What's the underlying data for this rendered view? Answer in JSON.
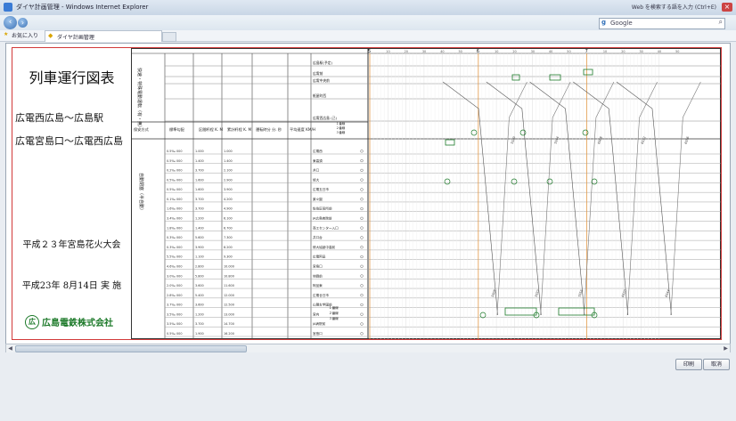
{
  "window": {
    "title": "ダイヤ計画管理 - Windows Internet Explorer",
    "search_hint": "Web を検索する語を入力 (Ctrl+E)",
    "close_label": "×"
  },
  "navbar": {
    "back_icon": "back-arrow-icon",
    "forward_icon": "forward-arrow-icon",
    "search_engine": "Google"
  },
  "favbar": {
    "favorites_label": "お気に入り",
    "tab_label": "ダイヤ計画管理"
  },
  "sheet": {
    "main_title": "列車運行図表",
    "section1": "広電西広島～広島駅",
    "section2": "広電宮島口～広電西広島",
    "event": "平成２３年宮島花火大会",
    "date": "平成23年 8月14日 実 施",
    "company": "広島電鉄株式会社",
    "logo_text": "広"
  },
  "table": {
    "header_vertical_top": "快速・特殊電動運転（有・無）",
    "header_row": [
      "保安方式",
      "標準勾配",
      "区間粁程 K. M",
      "累計粁程 K. M",
      "運転時分 分. 秒",
      "平均速度 KM/H"
    ],
    "vertical_label": "自動閉塞（半自動）",
    "gradients": [
      "0.5‰ 000",
      "0.5‰ 000",
      "0.2‰ 000",
      "0.5‰ 000",
      "0.5‰ 000",
      "0.1‰ 000",
      "1.6‰ 000",
      "3.4‰ 000",
      "1.8‰ 000",
      "0.3‰ 000",
      "0.3‰ 000",
      "5.5‰ 000",
      "4.6‰ 000",
      "3.0‰ 000",
      "2.0‰ 000",
      "2.8‰ 000",
      "3.7‰ 000",
      "3.5‰ 000",
      "3.5‰ 000",
      "0.5‰ 000"
    ],
    "section_km": [
      "1.000",
      "1.400",
      "3.700",
      "1.600",
      "1.600",
      "3.700",
      "3.700",
      "1.200",
      "1.400",
      "5.600",
      "3.900",
      "1.100",
      "2.800",
      "5.800",
      "3.600",
      "5.400",
      "3.600",
      "1.200",
      "3.700",
      "1.900"
    ],
    "cumulative_km": [
      "1.000",
      "1.400",
      "2.100",
      "2.900",
      "3.900",
      "4.200",
      "4.900",
      "6.100",
      "6.700",
      "7.300",
      "8.200",
      "9.300",
      "10.000",
      "10.800",
      "11.600",
      "12.000",
      "12.500",
      "13.000",
      "14.700",
      "16.200"
    ],
    "stations_top": [
      "広島駅(予定)",
      "広電前",
      "広電中央前",
      "紙屋町西",
      "広電西広島 (己)"
    ],
    "stations": [
      "広電西",
      "東高須",
      "井口",
      "修大",
      "広電五日市",
      "楽々園",
      "佐伯区役所前",
      "JA広島病院前",
      "商工センター入口",
      "井口台",
      "修大協創中高前",
      "広電阿品",
      "宮島口",
      "地御前",
      "阿品東",
      "広電廿日市",
      "山陽女学園前",
      "宮内",
      "JA病院前",
      "宮島口"
    ],
    "track_labels": [
      "１番線",
      "２番線",
      "３番線"
    ]
  },
  "diagram": {
    "hour_marks": [
      "5",
      "6",
      "7"
    ],
    "minute_marks": [
      "10",
      "20",
      "30",
      "40",
      "50"
    ],
    "train_numbers": [
      "5S08",
      "5S20",
      "5S32",
      "5S44",
      "5S56",
      "6S08",
      "6S20",
      "6S32",
      "6S44",
      "6S56"
    ]
  },
  "buttons": {
    "print": "印刷",
    "cancel": "取消"
  },
  "colors": {
    "accent": "#1d7a2a",
    "sheet_border": "#d23a3a",
    "grid": "#cfcfcf",
    "hour_line": "#e29a4a"
  }
}
